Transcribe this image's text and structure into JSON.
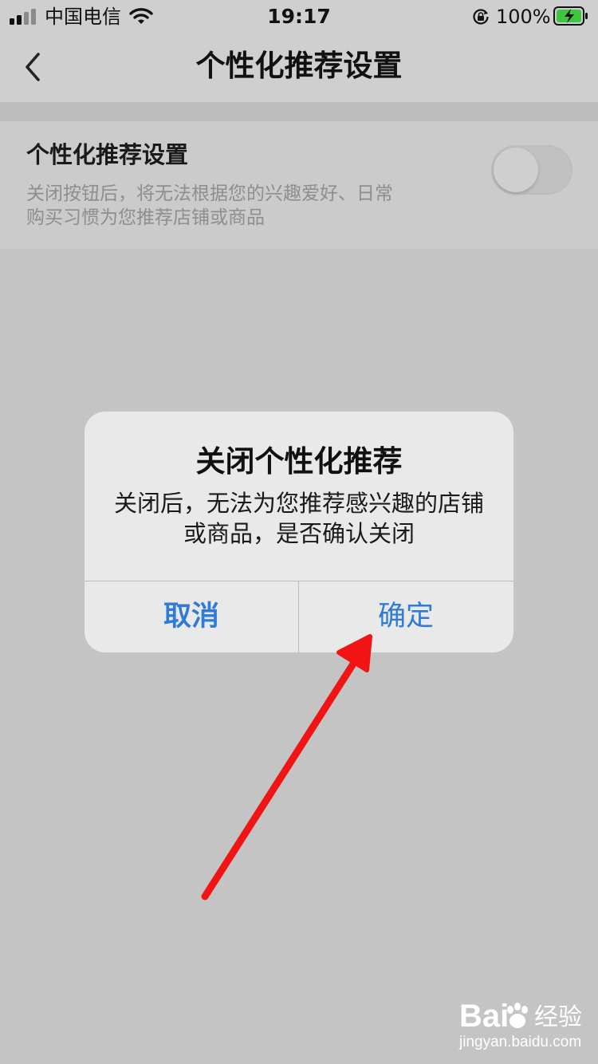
{
  "status_bar": {
    "carrier": "中国电信",
    "time": "19:17",
    "battery_percent": "100%",
    "icons": [
      "signal-icon",
      "wifi-icon",
      "rotation-lock-icon",
      "battery-charging-icon"
    ]
  },
  "nav": {
    "title": "个性化推荐设置",
    "back_icon": "chevron-left-icon"
  },
  "setting": {
    "title": "个性化推荐设置",
    "description": "关闭按钮后，将无法根据您的兴趣爱好、日常购买习惯为您推荐店铺或商品",
    "toggle_on": false
  },
  "dialog": {
    "title": "关闭个性化推荐",
    "message": "关闭后，无法为您推荐感兴趣的店铺或商品，是否确认关闭",
    "cancel_label": "取消",
    "confirm_label": "确定"
  },
  "watermark": {
    "logo_a": "Bai",
    "logo_b": "经验",
    "url": "jingyan.baidu.com"
  },
  "colors": {
    "accent_blue": "#2f7bd6",
    "annotation_red": "#f01414",
    "overlay_gray": "#c4c4c4"
  }
}
